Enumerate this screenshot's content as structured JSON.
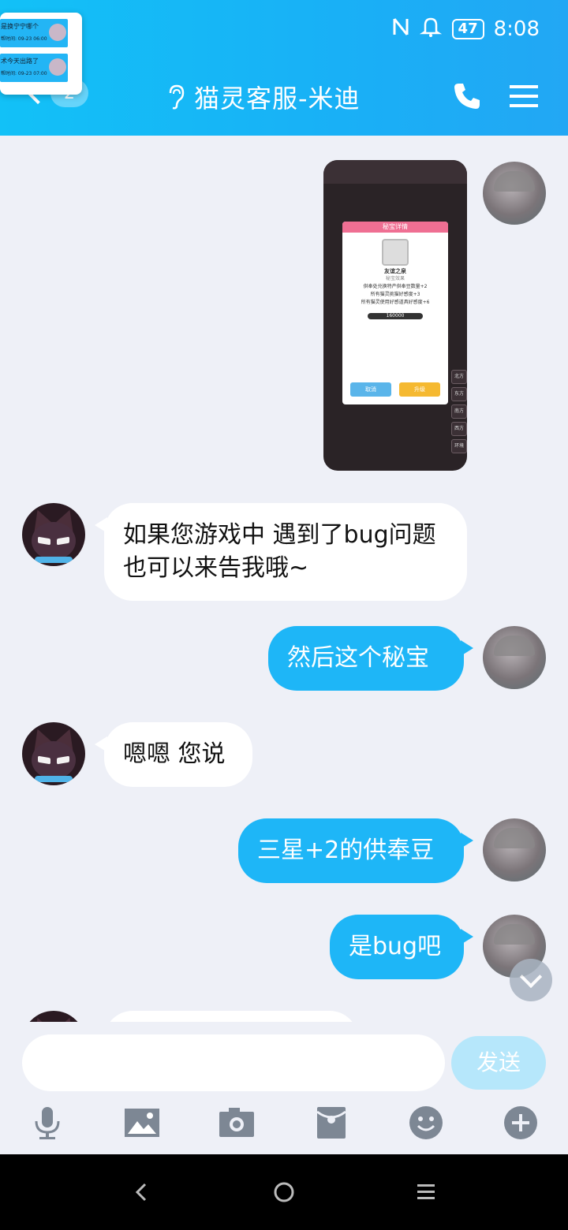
{
  "status_bar": {
    "battery": "47",
    "time": "8:08"
  },
  "header": {
    "back_badge": "2",
    "title": "猫灵客服-米迪"
  },
  "floating_card": {
    "items": [
      {
        "title": "是换宁宁哪个",
        "subtitle": "帮时间: 09-23 06:00"
      },
      {
        "title": "术今天出路了",
        "subtitle": "帮时间: 09-23 07:00"
      }
    ]
  },
  "screenshot_image": {
    "title": "秘宝详情",
    "item_name": "友谊之泉",
    "section": "秘宝效果",
    "lines": [
      "供奉处兑换特产供奉豆数量+2",
      "所有猫灵挑猫好感度+3",
      "所有猫灵使用好感道具好感度+6"
    ],
    "cost": "160000",
    "cancel": "取消",
    "upgrade": "升级",
    "side_tabs": [
      "北方",
      "东方",
      "南方",
      "西方",
      "环境"
    ]
  },
  "messages": [
    {
      "from": "agent",
      "text": "如果您游戏中 遇到了bug问题 也可以来告我哦~"
    },
    {
      "from": "me",
      "text": "然后这个秘宝"
    },
    {
      "from": "agent",
      "text": "嗯嗯 您说"
    },
    {
      "from": "me",
      "text": "三星+2的供奉豆"
    },
    {
      "from": "me",
      "text": "是bug吧"
    }
  ],
  "input": {
    "value": "",
    "send_label": "发送"
  },
  "colors": {
    "header": "#19b0f6",
    "bubble_me": "#1eb6f7",
    "bubble_agent": "#ffffff",
    "background": "#eef0f7"
  }
}
